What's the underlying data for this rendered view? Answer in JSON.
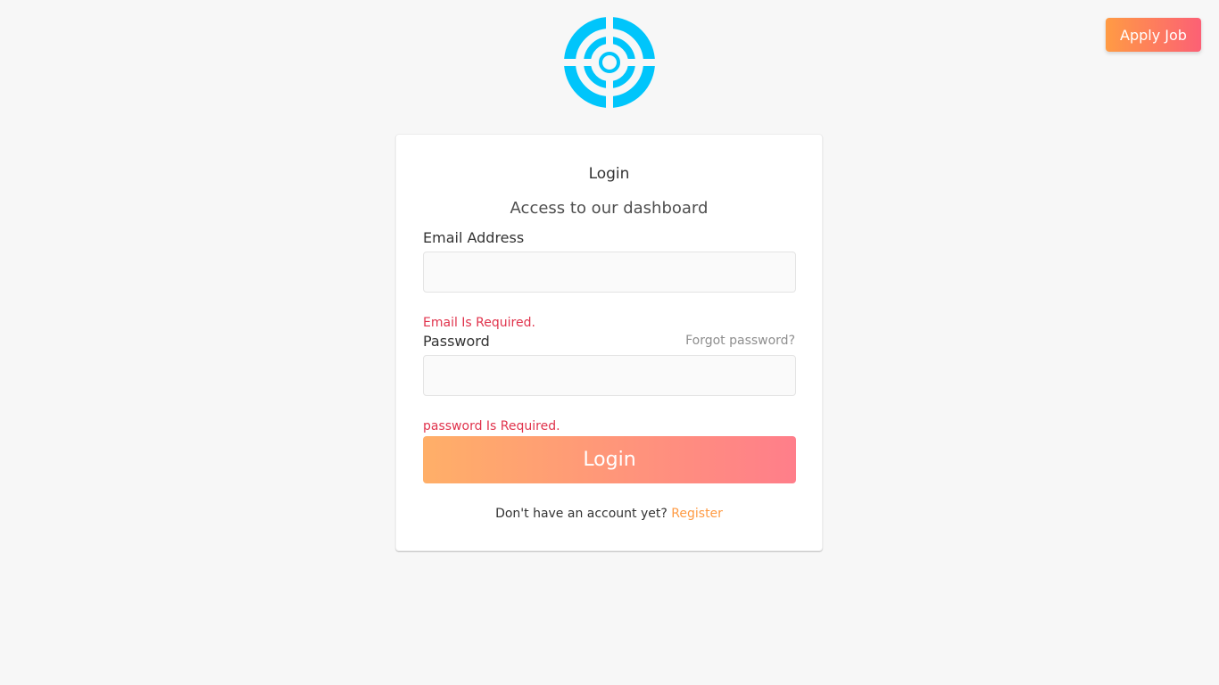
{
  "header": {
    "apply_job_label": "Apply Job"
  },
  "logo": {
    "icon": "target-logo-icon",
    "color": "#00c5fb"
  },
  "login_card": {
    "title": "Login",
    "subtitle": "Access to our dashboard",
    "email": {
      "label": "Email Address",
      "value": "",
      "error": "Email Is Required."
    },
    "password": {
      "label": "Password",
      "value": "",
      "error": "password Is Required.",
      "forgot_link": "Forgot password?"
    },
    "submit_label": "Login",
    "footer": {
      "text": "Don't have an account yet?",
      "register_link": "Register"
    }
  },
  "colors": {
    "background": "#f7f7f7",
    "accent_orange": "#ff9b44",
    "accent_pink": "#fc6075",
    "error": "#e0334c",
    "logo": "#00c5fb"
  }
}
